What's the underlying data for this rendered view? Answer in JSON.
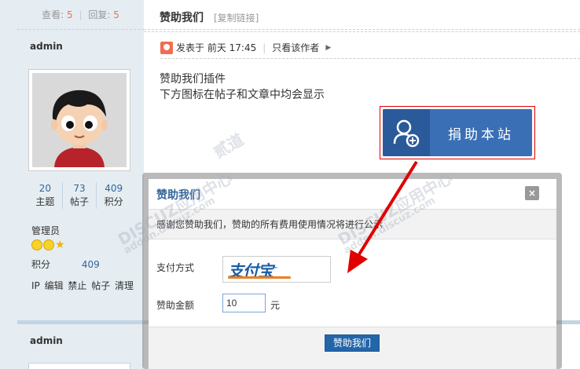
{
  "thread": {
    "views_label": "查看:",
    "views": "5",
    "replies_label": "回复:",
    "replies": "5",
    "title": "赞助我们",
    "copy_link": "[复制链接]"
  },
  "author": {
    "name": "admin",
    "stats": [
      {
        "value": "20",
        "label": "主题"
      },
      {
        "value": "73",
        "label": "帖子"
      },
      {
        "value": "409",
        "label": "积分"
      }
    ],
    "group": "管理员",
    "credit_label": "积分",
    "credit_value": "409",
    "admin_links": "IP 编辑 禁止 帖子 清理",
    "next_author": "admin"
  },
  "post": {
    "posted_label": "发表于",
    "posted_time": "前天 17:45",
    "only_author": "只看该作者",
    "line1": "赞助我们插件",
    "line2": "下方图标在帖子和文章中均会显示",
    "donate_button": "捐助本站"
  },
  "modal": {
    "title": "赞助我们",
    "close": "×",
    "notice": "感谢您赞助我们，赞助的所有费用使用情况将进行公示",
    "pay_method_label": "支付方式",
    "alipay_logo": "支付宝",
    "amount_label": "赞助金额",
    "amount_value": "10",
    "amount_unit": "元",
    "submit": "赞助我们"
  },
  "watermark": {
    "text1": "DISCUZ应用中心",
    "text2": "addon.discuz.com",
    "text3": "贰道"
  },
  "colors": {
    "accent_blue": "#336699",
    "count_red": "#f26c4f",
    "donate_blue": "#3a6fb5",
    "arrow_red": "#e00000"
  }
}
